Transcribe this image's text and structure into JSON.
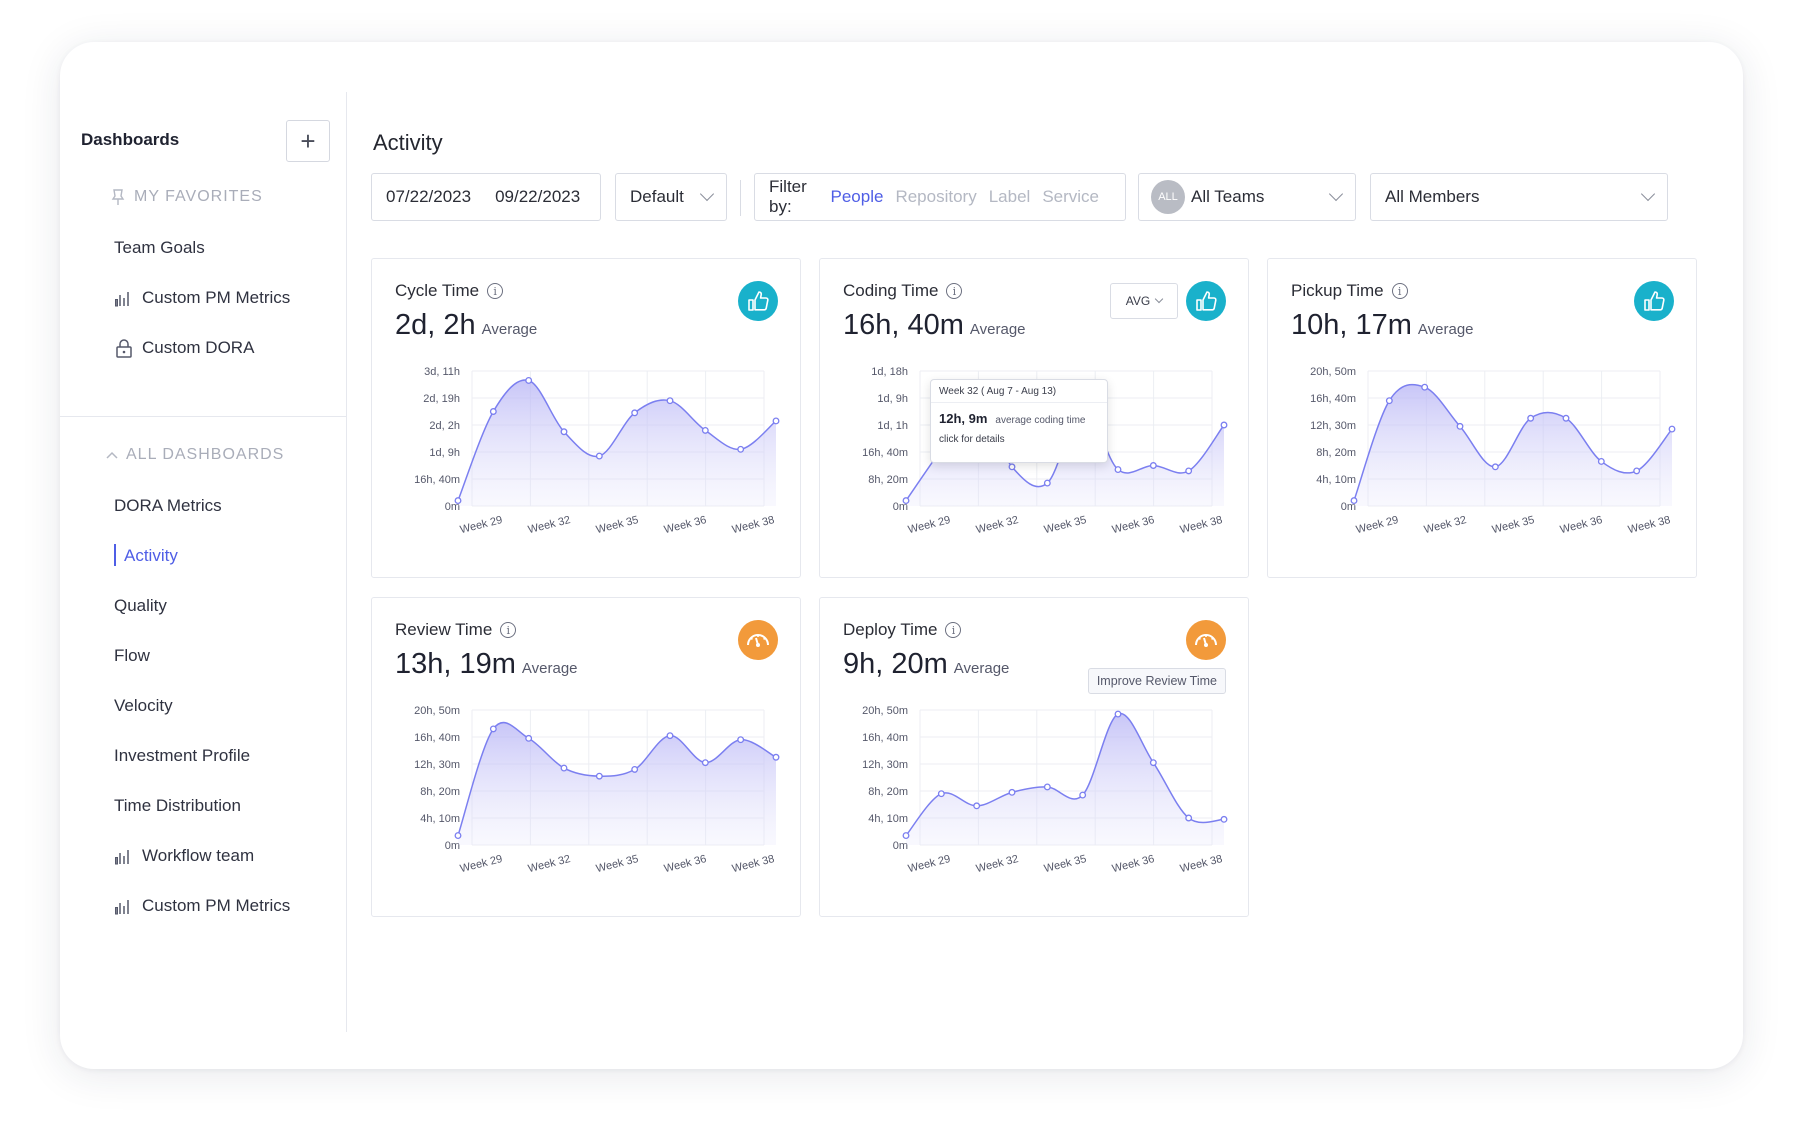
{
  "sidebar": {
    "title": "Dashboards",
    "add_label": "+",
    "favorites_label": "MY FAVORITES",
    "favorites": [
      {
        "label": "Team Goals",
        "icon": ""
      },
      {
        "label": "Custom PM Metrics",
        "icon": "bar-chart-icon"
      },
      {
        "label": "Custom DORA",
        "icon": "lock-icon"
      }
    ],
    "all_label": "ALL DASHBOARDS",
    "dashboards": [
      {
        "label": "DORA Metrics",
        "icon": ""
      },
      {
        "label": "Activity",
        "icon": "",
        "active": true
      },
      {
        "label": "Quality",
        "icon": ""
      },
      {
        "label": "Flow",
        "icon": ""
      },
      {
        "label": "Velocity",
        "icon": ""
      },
      {
        "label": "Investment Profile",
        "icon": ""
      },
      {
        "label": "Time Distribution",
        "icon": ""
      },
      {
        "label": "Workflow team",
        "icon": "bar-chart-icon"
      },
      {
        "label": "Custom PM Metrics",
        "icon": "bar-chart-icon"
      }
    ]
  },
  "main": {
    "title": "Activity",
    "date_from": "07/22/2023",
    "date_to": "09/22/2023",
    "view_select": "Default",
    "filter": {
      "label": "Filter by:",
      "options": [
        "People",
        "Repository",
        "Label",
        "Service"
      ],
      "selected": "People"
    },
    "teams_avatar": "ALL",
    "teams_select": "All Teams",
    "members_select": "All Members"
  },
  "colors": {
    "accent": "#4f5ee6",
    "good": "#19b1cb",
    "warn": "#f29a3b",
    "line": "#7b7ff0"
  },
  "cards": [
    {
      "name": "Cycle Time",
      "value": "2d, 2h",
      "suffix": "Average",
      "status": "thumbs-up-icon",
      "yticks": [
        "3d, 11h",
        "2d, 19h",
        "2d, 2h",
        "1d, 9h",
        "16h, 40m",
        "0m"
      ],
      "xticks": [
        "Week 29",
        "Week 32",
        "Week 35",
        "Week 36",
        "Week 38"
      ]
    },
    {
      "name": "Coding Time",
      "value": "16h, 40m",
      "suffix": "Average",
      "status": "thumbs-up-icon",
      "select": "AVG",
      "yticks": [
        "1d, 18h",
        "1d, 9h",
        "1d, 1h",
        "16h, 40m",
        "8h, 20m",
        "0m"
      ],
      "xticks": [
        "Week 29",
        "Week 32",
        "Week 35",
        "Week 36",
        "Week 38"
      ],
      "tooltip": {
        "head": "Week 32 ( Aug 7 - Aug 13)",
        "value": "12h, 9m",
        "value_label": "average coding time",
        "link": "click for details"
      }
    },
    {
      "name": "Pickup Time",
      "value": "10h, 17m",
      "suffix": "Average",
      "status": "thumbs-up-icon",
      "yticks": [
        "20h, 50m",
        "16h, 40m",
        "12h, 30m",
        "8h, 20m",
        "4h, 10m",
        "0m"
      ],
      "xticks": [
        "Week 29",
        "Week 32",
        "Week 35",
        "Week 36",
        "Week 38"
      ]
    },
    {
      "name": "Review Time",
      "value": "13h, 19m",
      "suffix": "Average",
      "status": "speedometer-icon",
      "yticks": [
        "20h, 50m",
        "16h, 40m",
        "12h, 30m",
        "8h, 20m",
        "4h, 10m",
        "0m"
      ],
      "xticks": [
        "Week 29",
        "Week 32",
        "Week 35",
        "Week 36",
        "Week 38"
      ]
    },
    {
      "name": "Deploy Time",
      "value": "9h, 20m",
      "suffix": "Average",
      "status": "speedometer-icon",
      "action": "Improve Review Time",
      "yticks": [
        "20h, 50m",
        "16h, 40m",
        "12h, 30m",
        "8h, 20m",
        "4h, 10m",
        "0m"
      ],
      "xticks": [
        "Week 29",
        "Week 32",
        "Week 35",
        "Week 36",
        "Week 38"
      ]
    }
  ],
  "chart_data": [
    {
      "type": "area",
      "title": "Cycle Time",
      "x": [
        1,
        2,
        3,
        4,
        5,
        6,
        7,
        8,
        9,
        10
      ],
      "y_norm": [
        0.04,
        0.7,
        0.93,
        0.55,
        0.37,
        0.69,
        0.78,
        0.56,
        0.42,
        0.63
      ]
    },
    {
      "type": "area",
      "title": "Coding Time",
      "x": [
        1,
        2,
        3,
        4,
        5,
        6,
        7,
        8,
        9,
        10
      ],
      "y_norm": [
        0.04,
        0.42,
        0.78,
        0.29,
        0.17,
        0.73,
        0.27,
        0.3,
        0.26,
        0.6
      ]
    },
    {
      "type": "area",
      "title": "Pickup Time",
      "x": [
        1,
        2,
        3,
        4,
        5,
        6,
        7,
        8,
        9,
        10
      ],
      "y_norm": [
        0.04,
        0.78,
        0.88,
        0.59,
        0.29,
        0.65,
        0.65,
        0.33,
        0.26,
        0.57
      ]
    },
    {
      "type": "area",
      "title": "Review Time",
      "x": [
        1,
        2,
        3,
        4,
        5,
        6,
        7,
        8,
        9,
        10
      ],
      "y_norm": [
        0.07,
        0.86,
        0.79,
        0.57,
        0.51,
        0.56,
        0.81,
        0.61,
        0.78,
        0.65
      ]
    },
    {
      "type": "area",
      "title": "Deploy Time",
      "x": [
        1,
        2,
        3,
        4,
        5,
        6,
        7,
        8,
        9,
        10
      ],
      "y_norm": [
        0.07,
        0.38,
        0.29,
        0.39,
        0.43,
        0.37,
        0.97,
        0.61,
        0.2,
        0.19
      ]
    }
  ]
}
